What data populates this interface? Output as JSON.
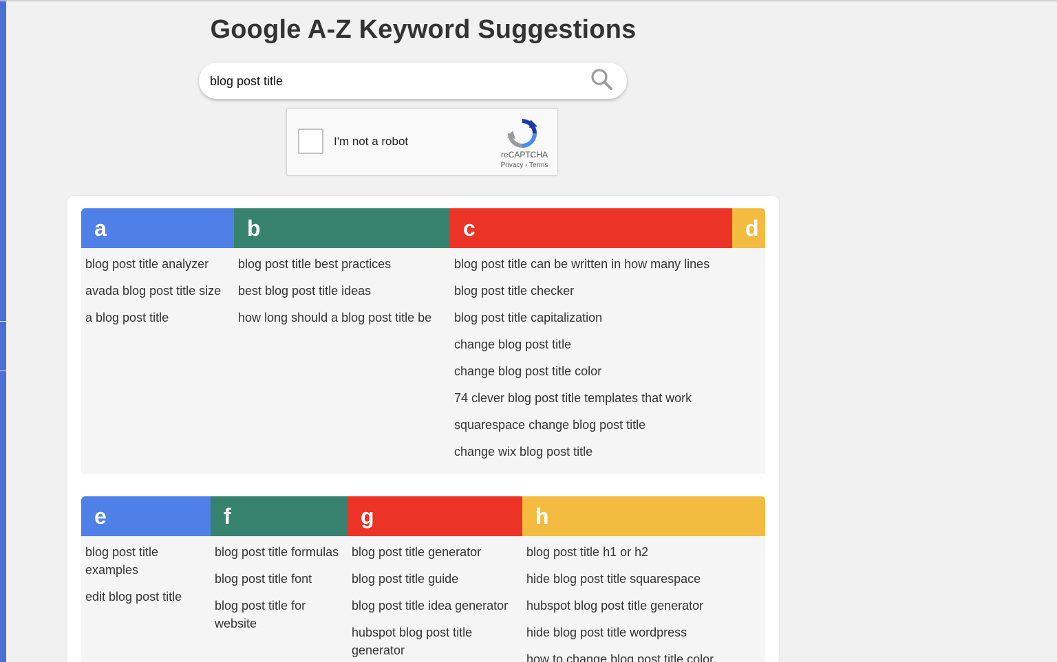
{
  "page": {
    "title": "Google A-Z Keyword Suggestions"
  },
  "search": {
    "value": "blog post title",
    "icon": "search-icon"
  },
  "captcha": {
    "label": "I'm not a robot",
    "brand": "reCAPTCHA",
    "links": "Privacy - Terms"
  },
  "colors": {
    "blue": "#4e80e8",
    "green": "#37826f",
    "red": "#eb3425",
    "yellow": "#f3bc40"
  },
  "groups": [
    {
      "letter": "a",
      "keywords": [
        "blog post title analyzer",
        "avada blog post title size",
        "a blog post title"
      ]
    },
    {
      "letter": "b",
      "keywords": [
        "blog post title best practices",
        "best blog post title ideas",
        "how long should a blog post title be"
      ]
    },
    {
      "letter": "c",
      "keywords": [
        "blog post title can be written in how many lines",
        "blog post title checker",
        "blog post title capitalization",
        "change blog post title",
        "change blog post title color",
        "74 clever blog post title templates that work",
        "squarespace change blog post title",
        "change wix blog post title"
      ]
    },
    {
      "letter": "d",
      "keywords": []
    },
    {
      "letter": "e",
      "keywords": [
        "blog post title examples",
        "edit blog post title"
      ]
    },
    {
      "letter": "f",
      "keywords": [
        "blog post title formulas",
        "blog post title font",
        "blog post title for website"
      ]
    },
    {
      "letter": "g",
      "keywords": [
        "blog post title generator",
        "blog post title guide",
        "blog post title idea generator",
        "hubspot blog post title generator"
      ]
    },
    {
      "letter": "h",
      "keywords": [
        "blog post title h1 or h2",
        "hide blog post title squarespace",
        "hubspot blog post title generator",
        "hide blog post title wordpress",
        "how to change blog post title color"
      ]
    }
  ]
}
